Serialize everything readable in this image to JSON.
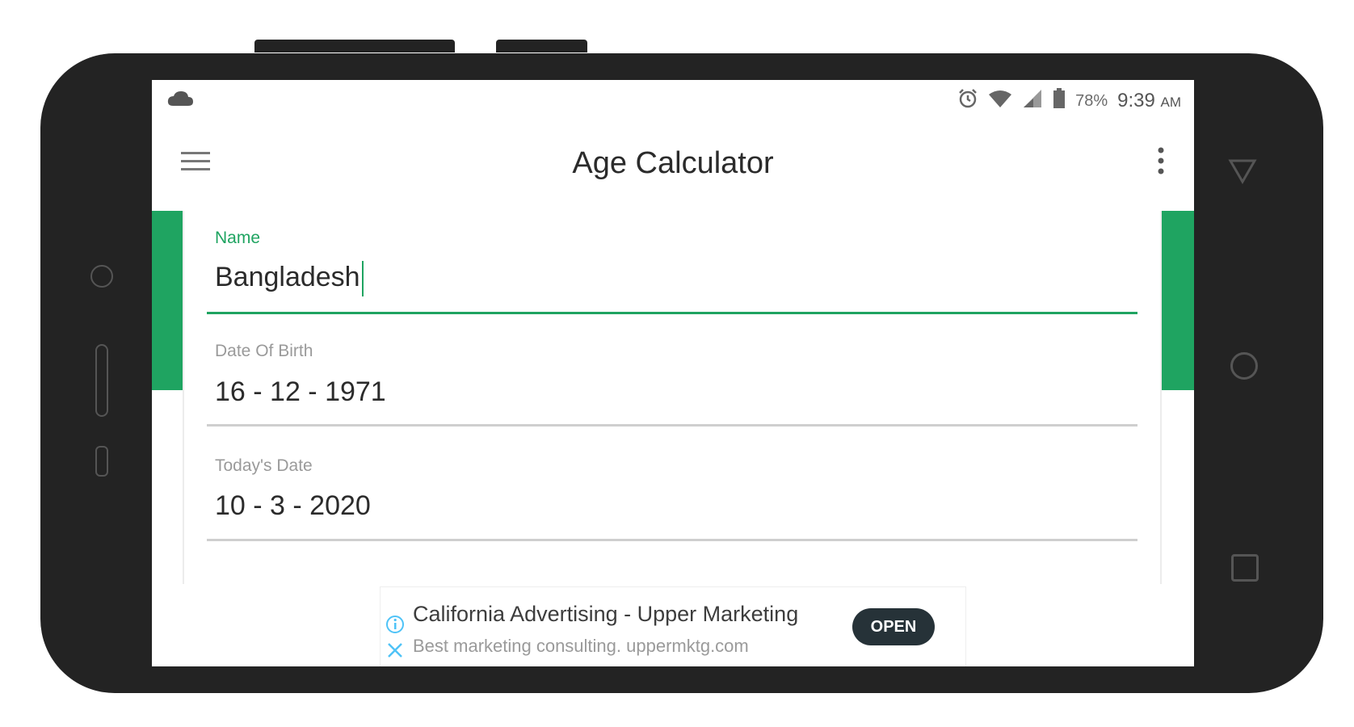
{
  "status_bar": {
    "cloud_icon": "cloud-icon",
    "alarm_icon": "alarm-icon",
    "wifi_icon": "wifi-icon",
    "signal_icon": "signal-icon",
    "battery_icon": "battery-icon",
    "battery": "78%",
    "time": "9:39",
    "ampm": "AM"
  },
  "app_bar": {
    "menu_icon": "hamburger-menu-icon",
    "title": "Age Calculator",
    "overflow_icon": "more-vert-icon"
  },
  "form": {
    "name_label": "Name",
    "name_value": "Bangladesh",
    "dob_label": "Date Of Birth",
    "dob_value": "16 - 12 - 1971",
    "today_label": "Today's Date",
    "today_value": "10 - 3 - 2020"
  },
  "ad": {
    "title": "California Advertising - Upper Marketing",
    "subtitle": "Best marketing consulting. uppermktg.com",
    "open_label": "OPEN",
    "info_icon": "info-icon",
    "close_icon": "close-icon"
  },
  "colors": {
    "accent": "#1fa461",
    "phone_body": "#232323",
    "ad_button": "#263238"
  },
  "device_buttons": [
    "back-triangle-icon",
    "home-circle-icon",
    "recents-square-icon"
  ]
}
